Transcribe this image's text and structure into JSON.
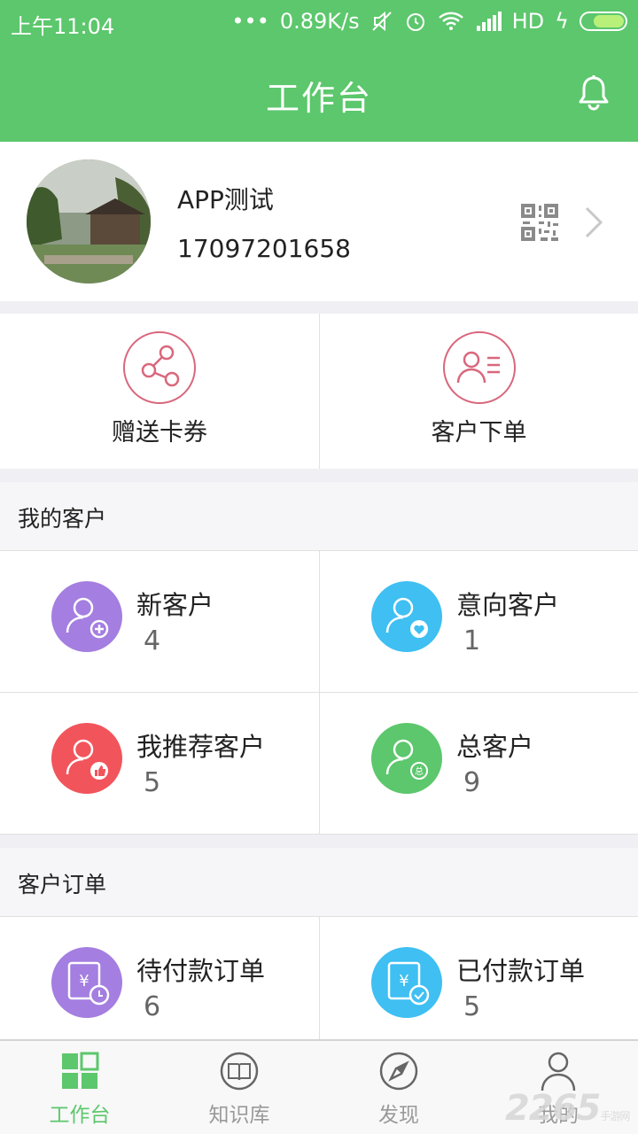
{
  "status_bar": {
    "time": "上午11:04",
    "net_speed": "0.89K/s",
    "network": "HD",
    "dots": "•••"
  },
  "header": {
    "title": "工作台"
  },
  "profile": {
    "name": "APP测试",
    "phone": "17097201658"
  },
  "quick_actions": [
    {
      "label": "赠送卡券",
      "icon": "share-icon"
    },
    {
      "label": "客户下单",
      "icon": "customer-list-icon"
    }
  ],
  "my_customers": {
    "title": "我的客户",
    "items": [
      {
        "label": "新客户",
        "count": "4",
        "color": "#a47ee0",
        "icon": "user-add-icon"
      },
      {
        "label": "意向客户",
        "count": "1",
        "color": "#3fbff2",
        "icon": "user-heart-icon"
      },
      {
        "label": "我推荐客户",
        "count": "5",
        "color": "#f2545b",
        "icon": "user-thumb-icon"
      },
      {
        "label": "总客户",
        "count": "9",
        "color": "#5cc76c",
        "icon": "user-total-icon"
      }
    ]
  },
  "customer_orders": {
    "title": "客户订单",
    "items": [
      {
        "label": "待付款订单",
        "count": "6",
        "color": "#a47ee0",
        "icon": "order-pending-icon"
      },
      {
        "label": "已付款订单",
        "count": "5",
        "color": "#3fbff2",
        "icon": "order-paid-icon"
      }
    ]
  },
  "tabs": [
    {
      "label": "工作台",
      "icon": "grid-icon",
      "active": true
    },
    {
      "label": "知识库",
      "icon": "book-icon",
      "active": false
    },
    {
      "label": "发现",
      "icon": "compass-icon",
      "active": false
    },
    {
      "label": "我的",
      "icon": "person-icon",
      "active": false
    }
  ],
  "colors": {
    "primary": "#5cc76c",
    "accent_ring": "#d9677c"
  },
  "watermark": {
    "brand": "2265",
    "sub": "手游网"
  }
}
